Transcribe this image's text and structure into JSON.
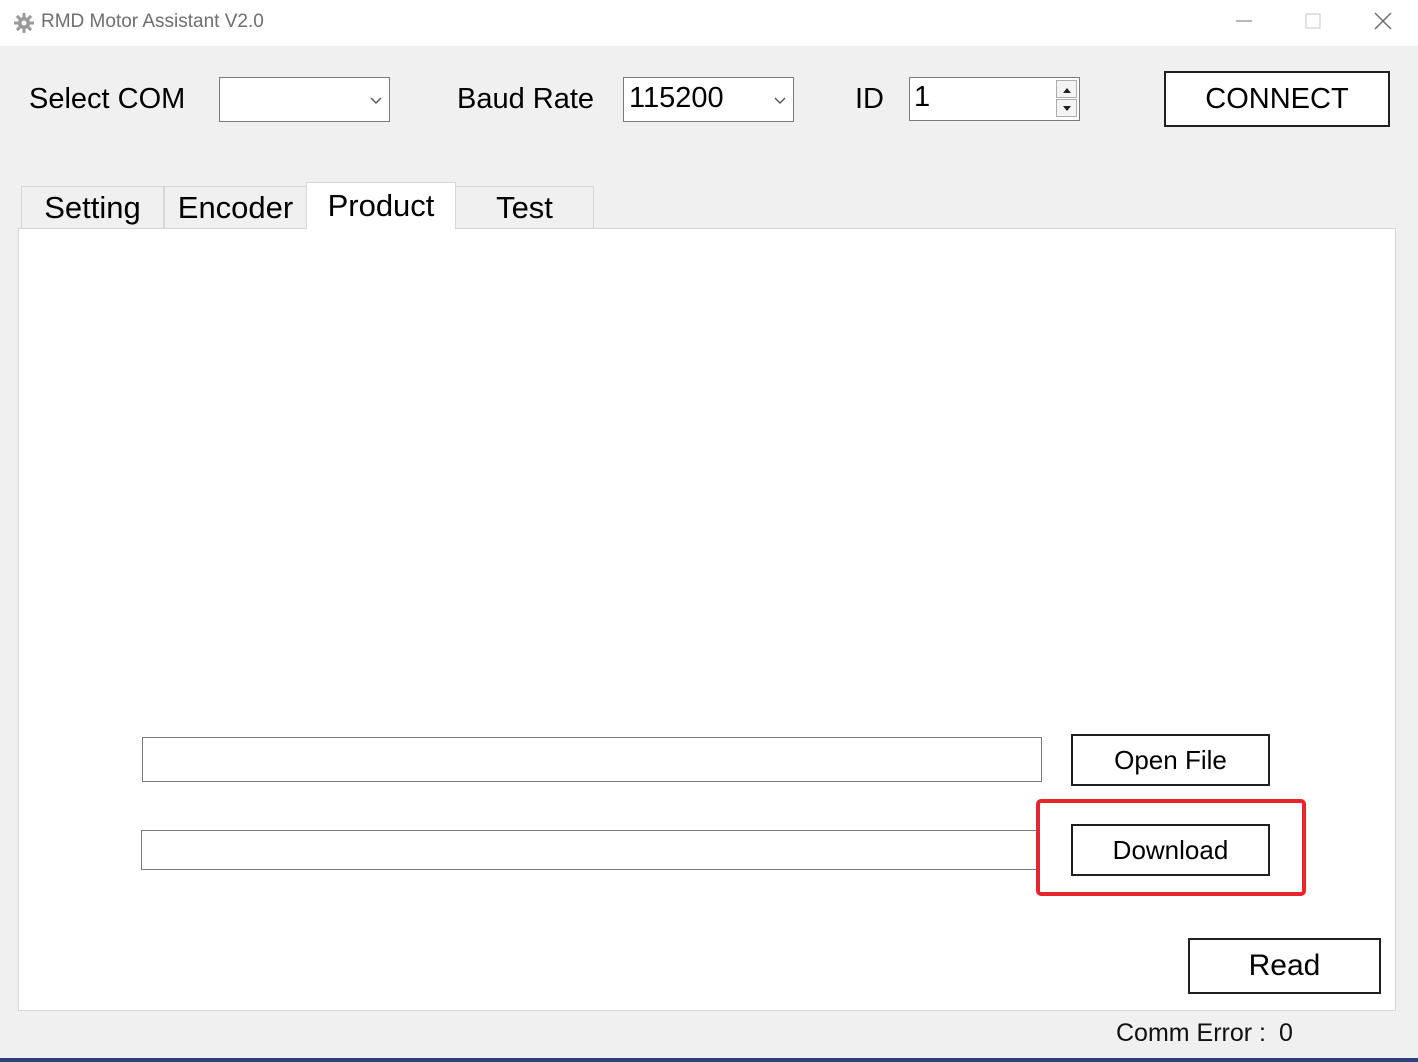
{
  "window": {
    "title": "RMD Motor Assistant V2.0",
    "app_icon": "gear-icon",
    "controls": [
      "minimize-icon",
      "maximize-icon",
      "close-icon"
    ]
  },
  "toolbar": {
    "com_label": "Select COM",
    "com_value": "",
    "baud_label": "Baud Rate",
    "baud_value": "115200",
    "id_label": "ID",
    "id_value": "1",
    "connect_label": "CONNECT"
  },
  "tabs": [
    {
      "label": "Setting",
      "active": false
    },
    {
      "label": "Encoder",
      "active": false
    },
    {
      "label": "Product",
      "active": true
    },
    {
      "label": "Test",
      "active": false
    }
  ],
  "product": {
    "file_path_value": "",
    "progress_value": "",
    "open_file_label": "Open File",
    "download_label": "Download",
    "read_label": "Read"
  },
  "status": {
    "comm_error_label": "Comm Error :",
    "comm_error_value": "0"
  },
  "colors": {
    "highlight": "#e8252a",
    "background": "#f0f0f0",
    "panel": "#ffffff"
  }
}
